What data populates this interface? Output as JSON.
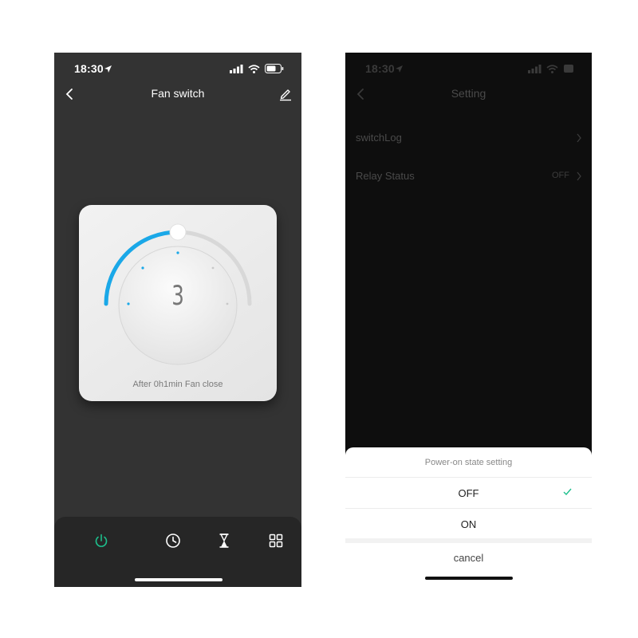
{
  "left": {
    "status": {
      "time": "18:30"
    },
    "nav": {
      "title": "Fan switch"
    },
    "knob": {
      "level": "3",
      "arc_fraction": 0.5
    },
    "timer_text": "After 0h1min Fan close",
    "tabs": [
      "power-icon",
      "clock-icon",
      "hourglass-icon",
      "grid-icon"
    ],
    "colors": {
      "accent": "#1aa8e8",
      "power": "#1dbf8c",
      "background": "#333333"
    }
  },
  "right": {
    "status": {
      "time": "18:30"
    },
    "nav": {
      "title": "Setting"
    },
    "rows": [
      {
        "label": "switchLog",
        "value": ""
      },
      {
        "label": "Relay Status",
        "value": "OFF"
      }
    ],
    "sheet": {
      "title": "Power-on state setting",
      "options": [
        {
          "label": "OFF",
          "selected": true
        },
        {
          "label": "ON",
          "selected": false
        }
      ],
      "cancel": "cancel"
    },
    "colors": {
      "check": "#1dbf8c"
    }
  }
}
